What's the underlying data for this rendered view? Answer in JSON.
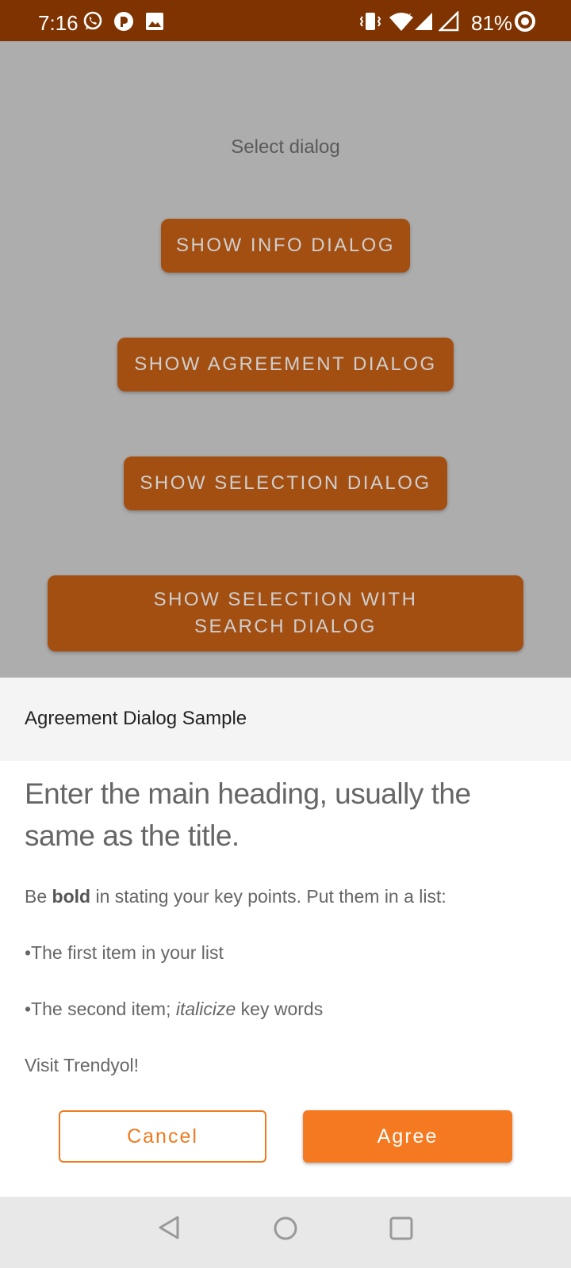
{
  "status_bar": {
    "time": "7:16",
    "battery": "81%",
    "left_icons": [
      "whatsapp-icon",
      "app-notification-icon",
      "image-icon"
    ],
    "right_icons": [
      "vibrate-icon",
      "wifi-icon",
      "signal-icon",
      "signal-icon-2",
      "battery-ring-icon"
    ]
  },
  "main": {
    "select_label": "Select dialog",
    "buttons": [
      "SHOW INFO DIALOG",
      "SHOW AGREEMENT DIALOG",
      "SHOW SELECTION DIALOG",
      "SHOW SELECTION WITH SEARCH DIALOG"
    ]
  },
  "dialog": {
    "title": "Agreement Dialog Sample",
    "heading": "Enter the main heading, usually the same as the title.",
    "para1": {
      "before": "Be ",
      "bold": "bold",
      "after": " in stating your key points. Put them in a list:"
    },
    "item1": "•The first item in your list",
    "item2": {
      "before": "•The second item; ",
      "italic": "italicize",
      "after": " key words"
    },
    "visit": "Visit Trendyol!",
    "cancel_label": "Cancel",
    "agree_label": "Agree"
  },
  "colors": {
    "status_bar": "#7f3300",
    "button_bg": "#a34f12",
    "accent": "#f47920",
    "scrim": "#adadad"
  },
  "nav_bar": {
    "icons": [
      "back-icon",
      "home-icon",
      "recents-icon"
    ]
  }
}
